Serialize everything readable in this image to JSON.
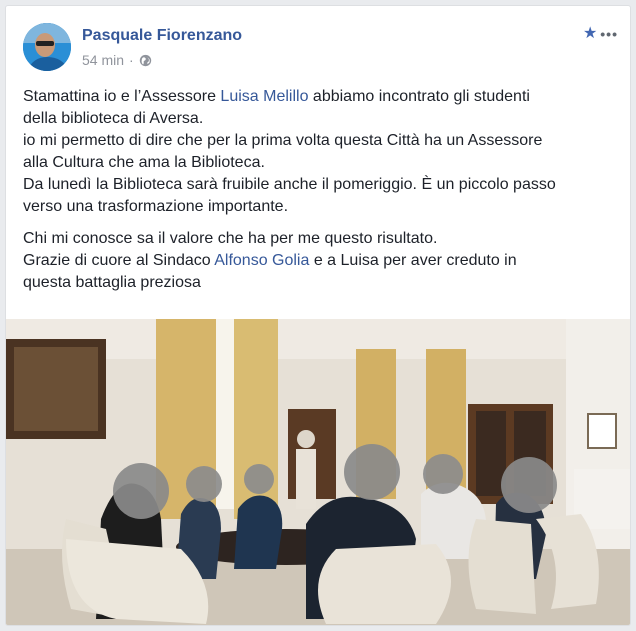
{
  "post": {
    "author": "Pasquale Fiorenzano",
    "time": "54 min",
    "separator": "·",
    "paragraph1": {
      "l1a": "Stamattina io e l’Assessore ",
      "l1link": "Luisa Melillo",
      "l1b": " abbiamo incontrato gli studenti",
      "l2": "della biblioteca di Aversa.",
      "l3": "io mi permetto di dire che per la prima volta questa Città ha un Assessore",
      "l4": "alla Cultura che ama la Biblioteca.",
      "l5": "Da lunedì la Biblioteca sarà fruibile anche il pomeriggio. È un piccolo passo",
      "l6": "verso una trasformazione importante."
    },
    "paragraph2": {
      "l1": "Chi mi conosce sa il valore che ha per me questo risultato.",
      "l2a": "Grazie di cuore al Sindaco ",
      "l2link": "Alfonso Golia",
      "l2b": " e a Luisa per aver creduto in",
      "l3": "questa battaglia preziosa"
    }
  },
  "icons": {
    "privacy": "globe-icon",
    "favorite": "star-icon",
    "menu": "more-options-icon"
  },
  "colors": {
    "link": "#365899",
    "accent": "#4267b2",
    "meta": "#90949c",
    "text": "#1d2129"
  }
}
